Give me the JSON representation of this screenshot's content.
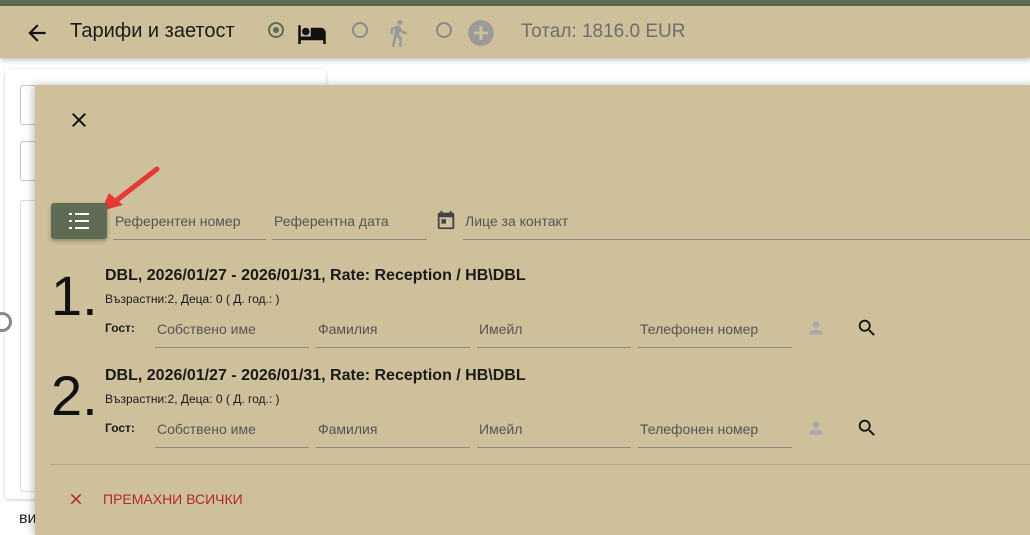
{
  "header": {
    "title": "Тарифи и заетост",
    "total": "Тотал: 1816.0 EUR",
    "modes": [
      {
        "icon": "bed-icon",
        "selected": true
      },
      {
        "icon": "walking-person-icon",
        "selected": false
      },
      {
        "icon": "add-circle-icon",
        "selected": false
      }
    ]
  },
  "background": {
    "footer_label": "ви"
  },
  "dialog": {
    "fields": {
      "reference_number": "Референтен номер",
      "reference_date": "Референтна дата",
      "contact_person": "Лице за контакт"
    },
    "rooms": [
      {
        "number": "1.",
        "title": "DBL, 2026/01/27 - 2026/01/31, Rate: Reception / HB\\DBL",
        "occupancy": "Възрастни:2, Деца: 0 ( Д. год.: )",
        "guest_label": "Гост:",
        "first_name": "Собствено име",
        "last_name": "Фамилия",
        "email": "Имейл",
        "phone": "Телефонен номер"
      },
      {
        "number": "2.",
        "title": "DBL, 2026/01/27 - 2026/01/31, Rate: Reception / HB\\DBL",
        "occupancy": "Възрастни:2, Деца: 0 ( Д. год.: )",
        "guest_label": "Гост:",
        "first_name": "Собствено име",
        "last_name": "Фамилия",
        "email": "Имейл",
        "phone": "Телефонен номер"
      }
    ],
    "remove_all": "ПРЕМАХНИ ВСИЧКИ"
  },
  "colors": {
    "header_bg": "#cfc09c",
    "accent": "#5f6b53",
    "danger": "#b02a20"
  }
}
